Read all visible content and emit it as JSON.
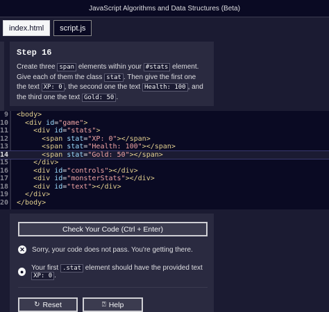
{
  "header": {
    "title": "JavaScript Algorithms and Data Structures (Beta)"
  },
  "tabs": [
    {
      "label": "index.html",
      "active": false
    },
    {
      "label": "script.js",
      "active": true
    }
  ],
  "instructions": {
    "step_title": "Step 16",
    "parts": [
      "Create three ",
      "span",
      " elements within your ",
      "#stats",
      " element. Give each of them the class ",
      "stat",
      ". Then give the first one the text ",
      "XP: 0",
      ", the second one the text ",
      "Health: 100",
      ", and the third one the text ",
      "Gold: 50",
      "."
    ]
  },
  "editor": {
    "current_line": 14,
    "lines": [
      {
        "n": "9",
        "indent": "",
        "text": "<body>"
      },
      {
        "n": "10",
        "indent": "  ",
        "text": "<div id=\"game\">"
      },
      {
        "n": "11",
        "indent": "    ",
        "text": "<div id=\"stats\">"
      },
      {
        "n": "12",
        "indent": "      ",
        "text": "<span stat=\"XP: 0\"></span>"
      },
      {
        "n": "13",
        "indent": "      ",
        "text": "<span stat=\"Health: 100\"></span>"
      },
      {
        "n": "14",
        "indent": "      ",
        "text": "<span stat=\"Gold: 50\"></span>"
      },
      {
        "n": "15",
        "indent": "    ",
        "text": "</div>"
      },
      {
        "n": "16",
        "indent": "    ",
        "text": "<div id=\"controls\"></div>"
      },
      {
        "n": "17",
        "indent": "    ",
        "text": "<div id=\"monsterStats\"></div>"
      },
      {
        "n": "18",
        "indent": "    ",
        "text": "<div id=\"text\"></div>"
      },
      {
        "n": "19",
        "indent": "  ",
        "text": "</div>"
      },
      {
        "n": "20",
        "indent": "",
        "text": "</body>"
      }
    ]
  },
  "results": {
    "check_label": "Check Your Code (Ctrl + Enter)",
    "fail_message": "Sorry, your code does not pass. You're getting there.",
    "hint_before": "Your first ",
    "hint_code1": ".stat",
    "hint_middle": " element should have the provided text ",
    "hint_code2": "XP: 0",
    "hint_after": ".",
    "reset_label": "Reset",
    "help_label": "Help"
  },
  "colors": {
    "bg": "#1b1b32",
    "panel": "#2a2a40",
    "editor_bg": "#0a0a23",
    "tag": "#e2cf8f",
    "attr": "#9cdcfe",
    "string": "#f1a4a4"
  }
}
